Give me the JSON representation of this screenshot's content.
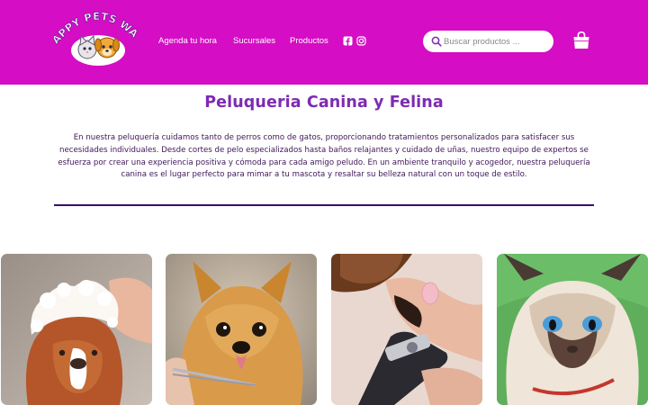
{
  "brand": {
    "logo_text": "HAPPY PETS WASH"
  },
  "colors": {
    "header_bg": "#d50dc4",
    "title": "#7c2bb3",
    "body_text": "#3f1659",
    "divider": "#3d0d63"
  },
  "nav": {
    "items": [
      {
        "label": "Agenda tu hora"
      },
      {
        "label": "Sucursales"
      },
      {
        "label": "Productos"
      }
    ],
    "social": [
      {
        "icon": "facebook-icon"
      },
      {
        "icon": "instagram-icon"
      }
    ]
  },
  "search": {
    "placeholder": "Buscar productos ..."
  },
  "cart": {
    "icon": "shopping-bag-icon"
  },
  "main": {
    "title": "Peluqueria Canina y Felina",
    "intro": "En nuestra peluquería cuidamos tanto de perros como de gatos, proporcionando tratamientos personalizados para satisfacer sus necesidades individuales. Desde cortes de pelo especializados hasta baños relajantes y cuidado de uñas, nuestro equipo de expertos se esfuerza por crear una experiencia positiva y cómoda para cada amigo peludo. En un ambiente tranquilo y acogedor, nuestra peluquería canina es el lugar perfecto para mimar a tu mascota y resaltar su belleza natural con un toque de estilo."
  },
  "gallery": [
    {
      "subject": "dog being bathed with foam"
    },
    {
      "subject": "yorkshire terrier getting a haircut"
    },
    {
      "subject": "dog paw nail trimming"
    },
    {
      "subject": "siamese kitten"
    }
  ]
}
